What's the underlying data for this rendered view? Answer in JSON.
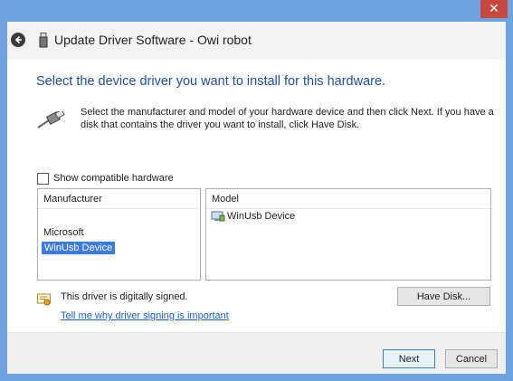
{
  "window": {
    "title": "Update Driver Software - Owi robot",
    "close_glyph": "✕"
  },
  "main": {
    "heading": "Select the device driver you want to install for this hardware.",
    "description": "Select the manufacturer and model of your hardware device and then click Next. If you have a disk that contains the driver you want to install, click Have Disk.",
    "show_compatible_label": "Show compatible hardware",
    "show_compatible_checked": false,
    "manufacturer": {
      "header": "Manufacturer",
      "items": [
        "Microsoft",
        "WinUsb Device"
      ],
      "selected": "WinUsb Device"
    },
    "model": {
      "header": "Model",
      "items": [
        "WinUsb Device"
      ]
    },
    "signed_text": "This driver is digitally signed.",
    "signing_link": "Tell me why driver signing is important",
    "have_disk_label": "Have Disk..."
  },
  "footer": {
    "next_label": "Next",
    "cancel_label": "Cancel"
  },
  "icons": {
    "back": "back-arrow-icon",
    "usb": "usb-device-icon",
    "certificate": "certificate-icon",
    "device": "device-driver-icon"
  },
  "colors": {
    "frame": "#6fa2e3",
    "heading": "#1f4fa0",
    "selection": "#3a7be6",
    "link": "#1a5fc6",
    "close": "#c7483e"
  }
}
